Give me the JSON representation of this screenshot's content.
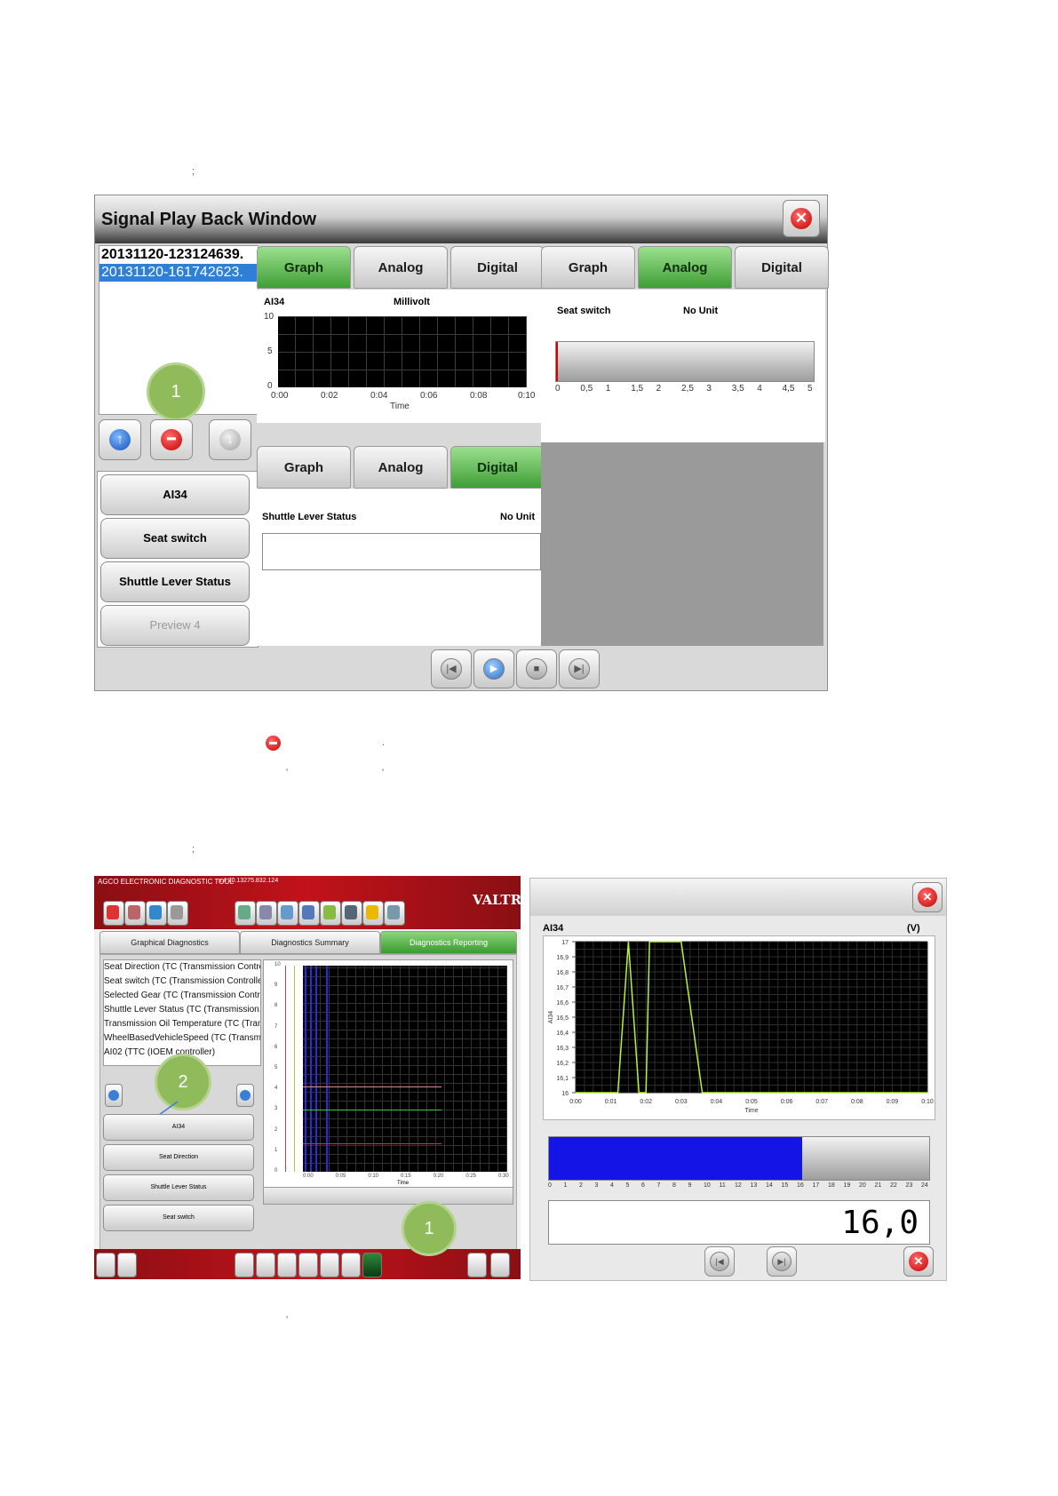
{
  "page_marks": {
    "mark1": ";",
    "mark2": ";",
    "mark3": "'",
    "mark4": "'",
    "mark5": "'",
    "mark6": "."
  },
  "playback_window": {
    "title": "Signal Play Back Window",
    "files": [
      "20131120-123124639.",
      "20131120-161742623."
    ],
    "selected_file_index": 1,
    "signal_buttons": [
      "AI34",
      "Seat switch",
      "Shuttle Lever Status",
      "Preview 4"
    ],
    "panel_graph": {
      "tabs": [
        "Graph",
        "Analog",
        "Digital"
      ],
      "active_tab": "Graph",
      "signal": "AI34",
      "unit": "Millivolt",
      "y_ticks": [
        "10",
        "5",
        "0"
      ],
      "x_ticks": [
        "0:00",
        "0:02",
        "0:04",
        "0:06",
        "0:08",
        "0:10"
      ],
      "x_label": "Time"
    },
    "panel_analog": {
      "tabs": [
        "Graph",
        "Analog",
        "Digital"
      ],
      "active_tab": "Analog",
      "signal": "Seat switch",
      "unit": "No Unit",
      "scale": [
        "0",
        "0,5",
        "1",
        "1,5",
        "2",
        "2,5",
        "3",
        "3,5",
        "4",
        "4,5",
        "5"
      ]
    },
    "panel_digital": {
      "tabs": [
        "Graph",
        "Analog",
        "Digital"
      ],
      "active_tab": "Digital",
      "signal": "Shuttle Lever Status",
      "unit": "No Unit"
    },
    "callout": "1"
  },
  "diag_tool": {
    "header": "AGCO ELECTRONIC DIAGNOSTIC TOOL",
    "version": "v.4.70.13275.832.124",
    "brand": "VALTRA",
    "tabs": [
      "Graphical Diagnostics",
      "Diagnostics Summary",
      "Diagnostics Reporting"
    ],
    "active_tab": "Diagnostics Reporting",
    "channels": [
      "Seat Direction (TC (Transmission Contro..",
      "Seat switch (TC (Transmission Controlle..",
      "Selected Gear (TC (Transmission Contro..",
      "Shuttle Lever Status (TC (Transmission..",
      "Transmission Oil Temperature (TC (Tran..",
      "WheelBasedVehicleSpeed (TC (Transmi..",
      "AI02 (TTC (IOEM controller)"
    ],
    "signal_buttons": [
      "AI34",
      "Seat Direction",
      "Shuttle Lever Status",
      "Seat switch"
    ],
    "y_ticks": [
      "10",
      "9",
      "8",
      "7",
      "6",
      "5",
      "4",
      "3",
      "2",
      "1",
      "0"
    ],
    "x_ticks": [
      "0:00",
      "0:05",
      "0:10",
      "0:15",
      "0:20",
      "0:25",
      "0:30"
    ],
    "x_label": "Time",
    "callouts": [
      "2",
      "1"
    ]
  },
  "signal_window": {
    "signal": "AI34",
    "unit": "(V)",
    "y_axis_label": "AI34",
    "x_label": "Time",
    "value": "16,0",
    "bar_scale": [
      "0",
      "1",
      "2",
      "3",
      "4",
      "5",
      "6",
      "7",
      "8",
      "9",
      "10",
      "11",
      "12",
      "13",
      "14",
      "15",
      "16",
      "17",
      "18",
      "19",
      "20",
      "21",
      "22",
      "23",
      "24"
    ],
    "bar_fraction": 0.6667
  },
  "chart_data": {
    "type": "line",
    "title": "AI34",
    "xlabel": "Time",
    "ylabel": "AI34",
    "x_ticks": [
      "0:00",
      "0:01",
      "0:02",
      "0:03",
      "0:04",
      "0:05",
      "0:06",
      "0:07",
      "0:08",
      "0:09",
      "0:10"
    ],
    "y_ticks": [
      "17",
      "16,9",
      "16,8",
      "16,7",
      "16,6",
      "16,5",
      "16,4",
      "16,3",
      "16,2",
      "16,1",
      "16"
    ],
    "ylim": [
      16,
      17
    ],
    "xlim": [
      0,
      10
    ],
    "series": [
      {
        "x": [
          0,
          1.2,
          1.5,
          1.8,
          2.0,
          2.1,
          3.0,
          3.6,
          10
        ],
        "y": [
          16,
          16,
          17,
          16,
          16,
          17,
          17,
          16,
          16
        ]
      }
    ]
  }
}
